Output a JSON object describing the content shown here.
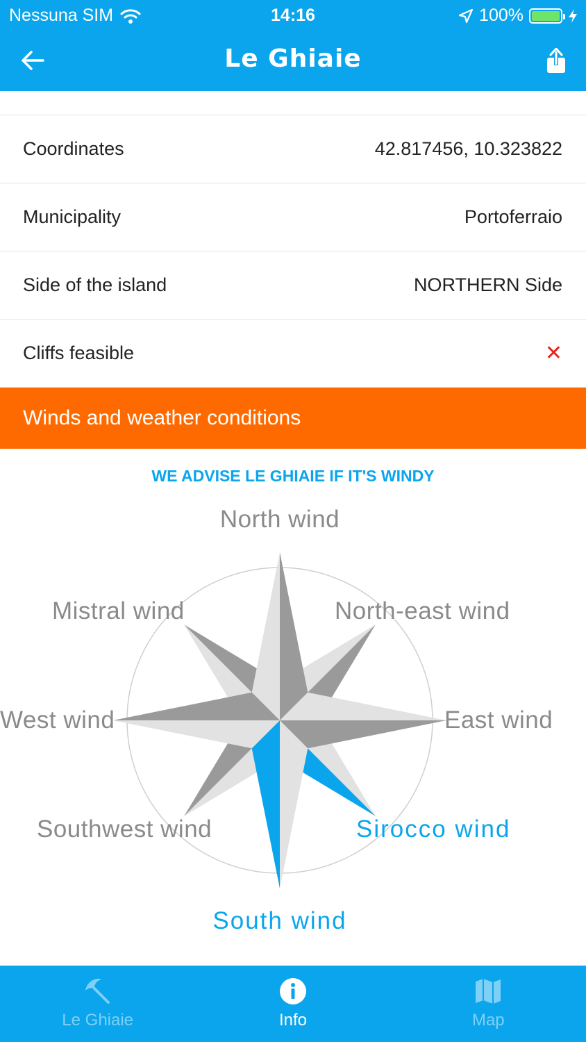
{
  "status_bar": {
    "carrier": "Nessuna SIM",
    "time": "14:16",
    "battery": "100%"
  },
  "nav": {
    "title": "Le Ghiaie"
  },
  "info_rows": [
    {
      "label": "Coordinates",
      "value": "42.817456, 10.323822"
    },
    {
      "label": "Municipality",
      "value": "Portoferraio"
    },
    {
      "label": "Side of the island",
      "value": "NORTHERN Side"
    },
    {
      "label": "Cliffs feasible",
      "value": "✕"
    }
  ],
  "section": {
    "title": "Winds and weather conditions"
  },
  "wind": {
    "advice": "WE ADVISE LE GHIAIE IF IT'S WINDY",
    "labels": {
      "north": "North wind",
      "northeast": "North-east wind",
      "east": "East wind",
      "southeast": "Sirocco wind",
      "south": "South wind",
      "southwest": "Southwest wind",
      "west": "West wind",
      "northwest": "Mistral wind"
    },
    "highlighted": [
      "south",
      "southeast"
    ],
    "colors": {
      "highlight": "#0aa5ec",
      "dark": "#9a9a9a",
      "light": "#e2e2e2",
      "circle": "#cfcfcf"
    }
  },
  "tabs": [
    {
      "label": "Le Ghiaie",
      "icon": "beach-umbrella-icon",
      "active": false
    },
    {
      "label": "Info",
      "icon": "info-icon",
      "active": true
    },
    {
      "label": "Map",
      "icon": "map-icon",
      "active": false
    }
  ],
  "colors": {
    "brand_blue": "#0aa5ec",
    "section_orange": "#ff6a00",
    "negative_red": "#e2231a"
  }
}
